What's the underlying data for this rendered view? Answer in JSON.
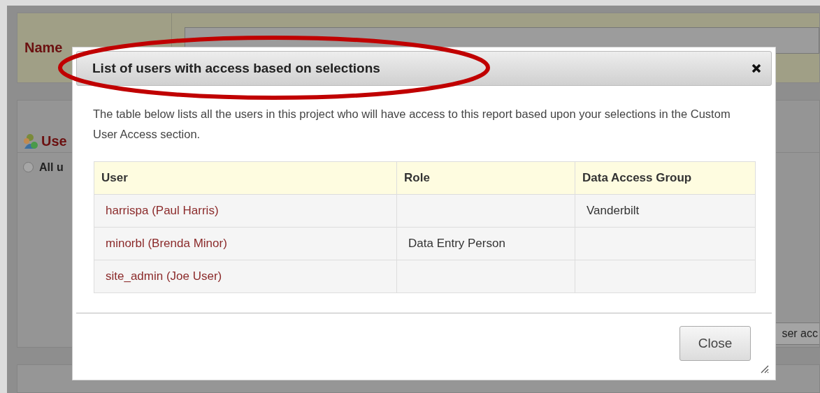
{
  "background": {
    "name_label": "Name",
    "section_title": "Use",
    "radio_option": {
      "label": "All u",
      "selected": false
    },
    "side_button": "ser acc"
  },
  "dialog": {
    "title": "List of users with access based on selections",
    "description": "The table below lists all the users in this project who will have access to this report based upon your selections in the Custom User Access section.",
    "table": {
      "columns": [
        "User",
        "Role",
        "Data Access Group"
      ],
      "rows": [
        {
          "user": "harrispa (Paul Harris)",
          "group": "Vanderbilt"
        },
        {
          "user": "minorbl (Brenda Minor)",
          "role": "Data Entry Person"
        },
        {
          "user": "site_admin (Joe User)"
        }
      ]
    },
    "buttons": [
      "Close"
    ]
  }
}
